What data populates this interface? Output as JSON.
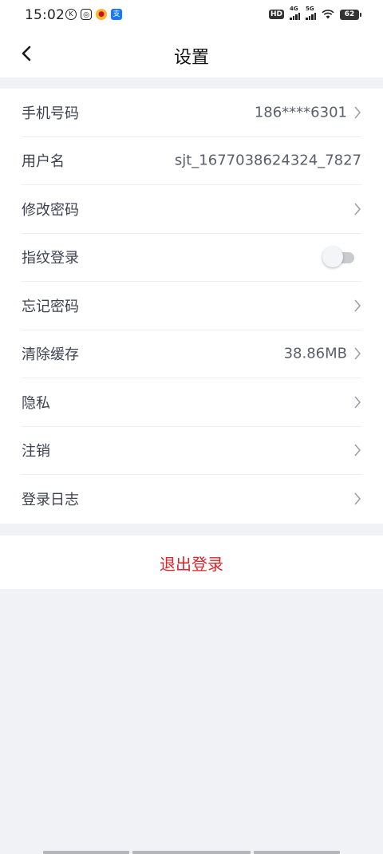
{
  "status_bar": {
    "time": "15:02",
    "left_icons": [
      "k-app-icon",
      "camera-app-icon",
      "weibo-icon",
      "alipay-icon"
    ],
    "hd_label": "HD",
    "signal_1_label": "4G",
    "signal_2_label": "5G",
    "battery_level": "62"
  },
  "nav": {
    "title": "设置",
    "back_icon": "chevron-left-icon"
  },
  "settings": {
    "phone": {
      "label": "手机号码",
      "value": "186****6301"
    },
    "username": {
      "label": "用户名",
      "value": "sjt_1677038624324_7827"
    },
    "change_password": {
      "label": "修改密码"
    },
    "fingerprint_login": {
      "label": "指纹登录",
      "enabled": false
    },
    "forgot_password": {
      "label": "忘记密码"
    },
    "clear_cache": {
      "label": "清除缓存",
      "value": "38.86MB"
    },
    "privacy": {
      "label": "隐私"
    },
    "deactivate": {
      "label": "注销"
    },
    "login_log": {
      "label": "登录日志"
    }
  },
  "logout": {
    "label": "退出登录",
    "color": "#d9252b"
  },
  "colors": {
    "background": "#f1f2f6",
    "surface": "#ffffff",
    "label_text": "#3e4250",
    "value_text": "#5a5e6b",
    "divider": "#eceef2"
  }
}
